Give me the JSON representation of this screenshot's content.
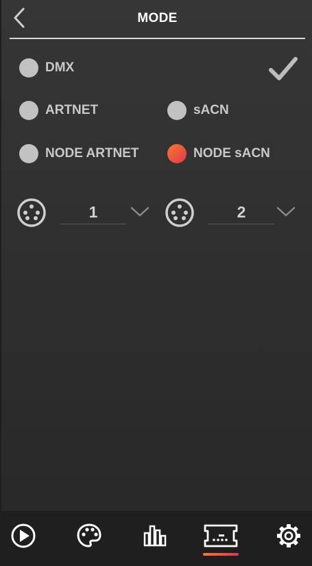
{
  "header": {
    "title": "MODE",
    "back_icon": "chevron-left-icon",
    "confirm_icon": "checkmark-icon"
  },
  "modes": [
    {
      "label": "DMX",
      "selected": false
    },
    {
      "label": "ARTNET",
      "selected": false
    },
    {
      "label": "sACN",
      "selected": false
    },
    {
      "label": "NODE ARTNET",
      "selected": false
    },
    {
      "label": "NODE sACN",
      "selected": true
    }
  ],
  "ports": [
    {
      "value": "1",
      "icon": "dmx-connector-icon"
    },
    {
      "value": "2",
      "icon": "dmx-connector-icon"
    }
  ],
  "bottom_nav": [
    {
      "icon": "play-icon"
    },
    {
      "icon": "palette-icon"
    },
    {
      "icon": "equalizer-icon"
    },
    {
      "icon": "dmx-console-icon",
      "active": true
    },
    {
      "icon": "gear-icon"
    }
  ],
  "colors": {
    "accent_start": "#f47b2a",
    "accent_end": "#e8344f",
    "radio_unselected": "#c2c2c2",
    "text": "#c9c9c9"
  }
}
